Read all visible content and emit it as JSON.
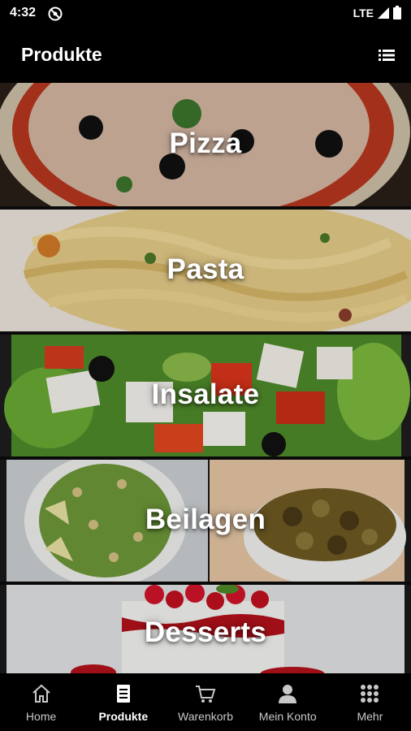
{
  "status_bar": {
    "time": "4:32",
    "network": "LTE",
    "icons": [
      "do-not-disturb-icon",
      "signal-icon",
      "battery-icon"
    ]
  },
  "app_bar": {
    "title": "Produkte",
    "action_icon": "list-view-icon"
  },
  "categories": [
    {
      "label": "Pizza"
    },
    {
      "label": "Pasta"
    },
    {
      "label": "Insalate"
    },
    {
      "label": "Beilagen"
    },
    {
      "label": "Desserts"
    }
  ],
  "bottom_nav": {
    "items": [
      {
        "label": "Home",
        "icon": "home-icon",
        "active": false
      },
      {
        "label": "Produkte",
        "icon": "menu-card-icon",
        "active": true
      },
      {
        "label": "Warenkorb",
        "icon": "cart-icon",
        "active": false
      },
      {
        "label": "Mein Konto",
        "icon": "person-icon",
        "active": false
      },
      {
        "label": "Mehr",
        "icon": "grid-icon",
        "active": false
      }
    ]
  },
  "colors": {
    "background": "#000000",
    "nav_inactive": "#c8c8c8",
    "nav_active": "#ffffff"
  }
}
